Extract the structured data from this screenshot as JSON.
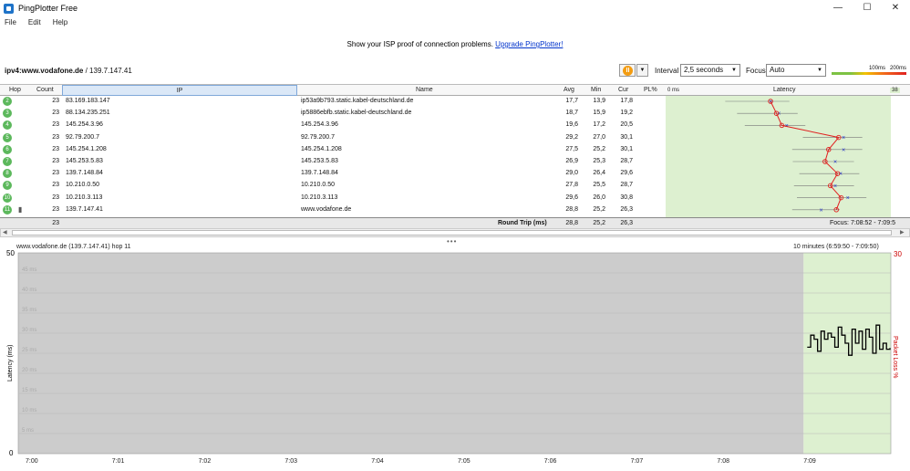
{
  "window": {
    "title": "PingPlotter Free",
    "minimize": "—",
    "maximize": "☐",
    "close": "✕"
  },
  "menu": [
    "File",
    "Edit",
    "Help"
  ],
  "banner": {
    "text": "Show your ISP proof of connection problems.",
    "link": "Upgrade PingPlotter!"
  },
  "toolbar": {
    "target_bold": "ipv4:www.vodafone.de",
    "target_rest": " / 139.7.147.41",
    "pause_icon": "pause-icon",
    "interval_label": "Interval",
    "interval_value": "2,5 seconds",
    "focus_label": "Focus",
    "focus_value": "Auto",
    "legend_100": "100ms",
    "legend_200": "200ms"
  },
  "table": {
    "headers": {
      "hop": "Hop",
      "count": "Count",
      "ip": "IP",
      "name": "Name",
      "avg": "Avg",
      "min": "Min",
      "cur": "Cur",
      "pl": "PL%",
      "zero": "0 ms",
      "latency": "Latency",
      "max": "38"
    },
    "rows": [
      {
        "hop": "2",
        "count": "23",
        "ip": "83.169.183.147",
        "name": "ip53a9b793.static.kabel-deutschland.de",
        "avg": "17,7",
        "min": "13,9",
        "cur": "17,8",
        "pl": ""
      },
      {
        "hop": "3",
        "count": "23",
        "ip": "88.134.235.251",
        "name": "ip5886ebfb.static.kabel-deutschland.de",
        "avg": "18,7",
        "min": "15,9",
        "cur": "19,2",
        "pl": ""
      },
      {
        "hop": "4",
        "count": "23",
        "ip": "145.254.3.96",
        "name": "145.254.3.96",
        "avg": "19,6",
        "min": "17,2",
        "cur": "20,5",
        "pl": ""
      },
      {
        "hop": "5",
        "count": "23",
        "ip": "92.79.200.7",
        "name": "92.79.200.7",
        "avg": "29,2",
        "min": "27,0",
        "cur": "30,1",
        "pl": ""
      },
      {
        "hop": "6",
        "count": "23",
        "ip": "145.254.1.208",
        "name": "145.254.1.208",
        "avg": "27,5",
        "min": "25,2",
        "cur": "30,1",
        "pl": ""
      },
      {
        "hop": "7",
        "count": "23",
        "ip": "145.253.5.83",
        "name": "145.253.5.83",
        "avg": "26,9",
        "min": "25,3",
        "cur": "28,7",
        "pl": ""
      },
      {
        "hop": "8",
        "count": "23",
        "ip": "139.7.148.84",
        "name": "139.7.148.84",
        "avg": "29,0",
        "min": "26,4",
        "cur": "29,6",
        "pl": ""
      },
      {
        "hop": "9",
        "count": "23",
        "ip": "10.210.0.50",
        "name": "10.210.0.50",
        "avg": "27,8",
        "min": "25,5",
        "cur": "28,7",
        "pl": ""
      },
      {
        "hop": "10",
        "count": "23",
        "ip": "10.210.3.113",
        "name": "10.210.3.113",
        "avg": "29,6",
        "min": "26,0",
        "cur": "30,8",
        "pl": ""
      },
      {
        "hop": "11",
        "count": "23",
        "ip": "139.7.147.41",
        "name": "www.vodafone.de",
        "avg": "28,8",
        "min": "25,2",
        "cur": "26,3",
        "pl": ""
      }
    ],
    "round_trip": {
      "count": "23",
      "label": "Round Trip (ms)",
      "avg": "28,8",
      "min": "25,2",
      "cur": "26,3",
      "focus": "Focus: 7:08:52 - 7:09:5"
    },
    "hop_latency": {
      "max_ms": 38,
      "avg": [
        17.7,
        18.7,
        19.6,
        29.2,
        27.5,
        26.9,
        29.0,
        27.8,
        29.6,
        28.8
      ],
      "cur": [
        17.8,
        19.2,
        20.5,
        30.1,
        30.1,
        28.7,
        29.6,
        28.7,
        30.8,
        26.3
      ],
      "min": [
        13.9,
        15.9,
        17.2,
        27.0,
        25.2,
        25.3,
        26.4,
        25.5,
        26.0,
        25.2
      ]
    }
  },
  "graph": {
    "title": "www.vodafone.de (139.7.147.41) hop 11",
    "range": "10 minutes (6:59:50 - 7:09:50)",
    "y_label": "Latency (ms)",
    "y2_label": "Packet Loss %",
    "y_top": "50",
    "y_bottom": "0",
    "y2_top": "30",
    "y_ticks": [
      "45 ms",
      "40 ms",
      "35 ms",
      "30 ms",
      "25 ms",
      "20 ms",
      "15 ms",
      "10 ms",
      "5 ms"
    ],
    "x_ticks": [
      "7:00",
      "7:01",
      "7:02",
      "7:03",
      "7:04",
      "7:05",
      "7:06",
      "7:07",
      "7:08",
      "7:09"
    ],
    "colors": {
      "no_data": "#cccccc",
      "ok": "#ddf0d0",
      "line": "#000000",
      "loss": "#cc0000"
    },
    "series_ms": [
      26.5,
      29.5,
      28.5,
      25.5,
      30.5,
      28.5,
      30.0,
      29.0,
      26.5,
      31.5,
      29.5,
      27.5,
      24.5,
      31.0,
      27.5,
      30.5,
      26.0,
      31.0,
      29.0,
      25.0,
      32.0,
      26.0,
      27.5,
      26.0,
      26.3
    ]
  }
}
